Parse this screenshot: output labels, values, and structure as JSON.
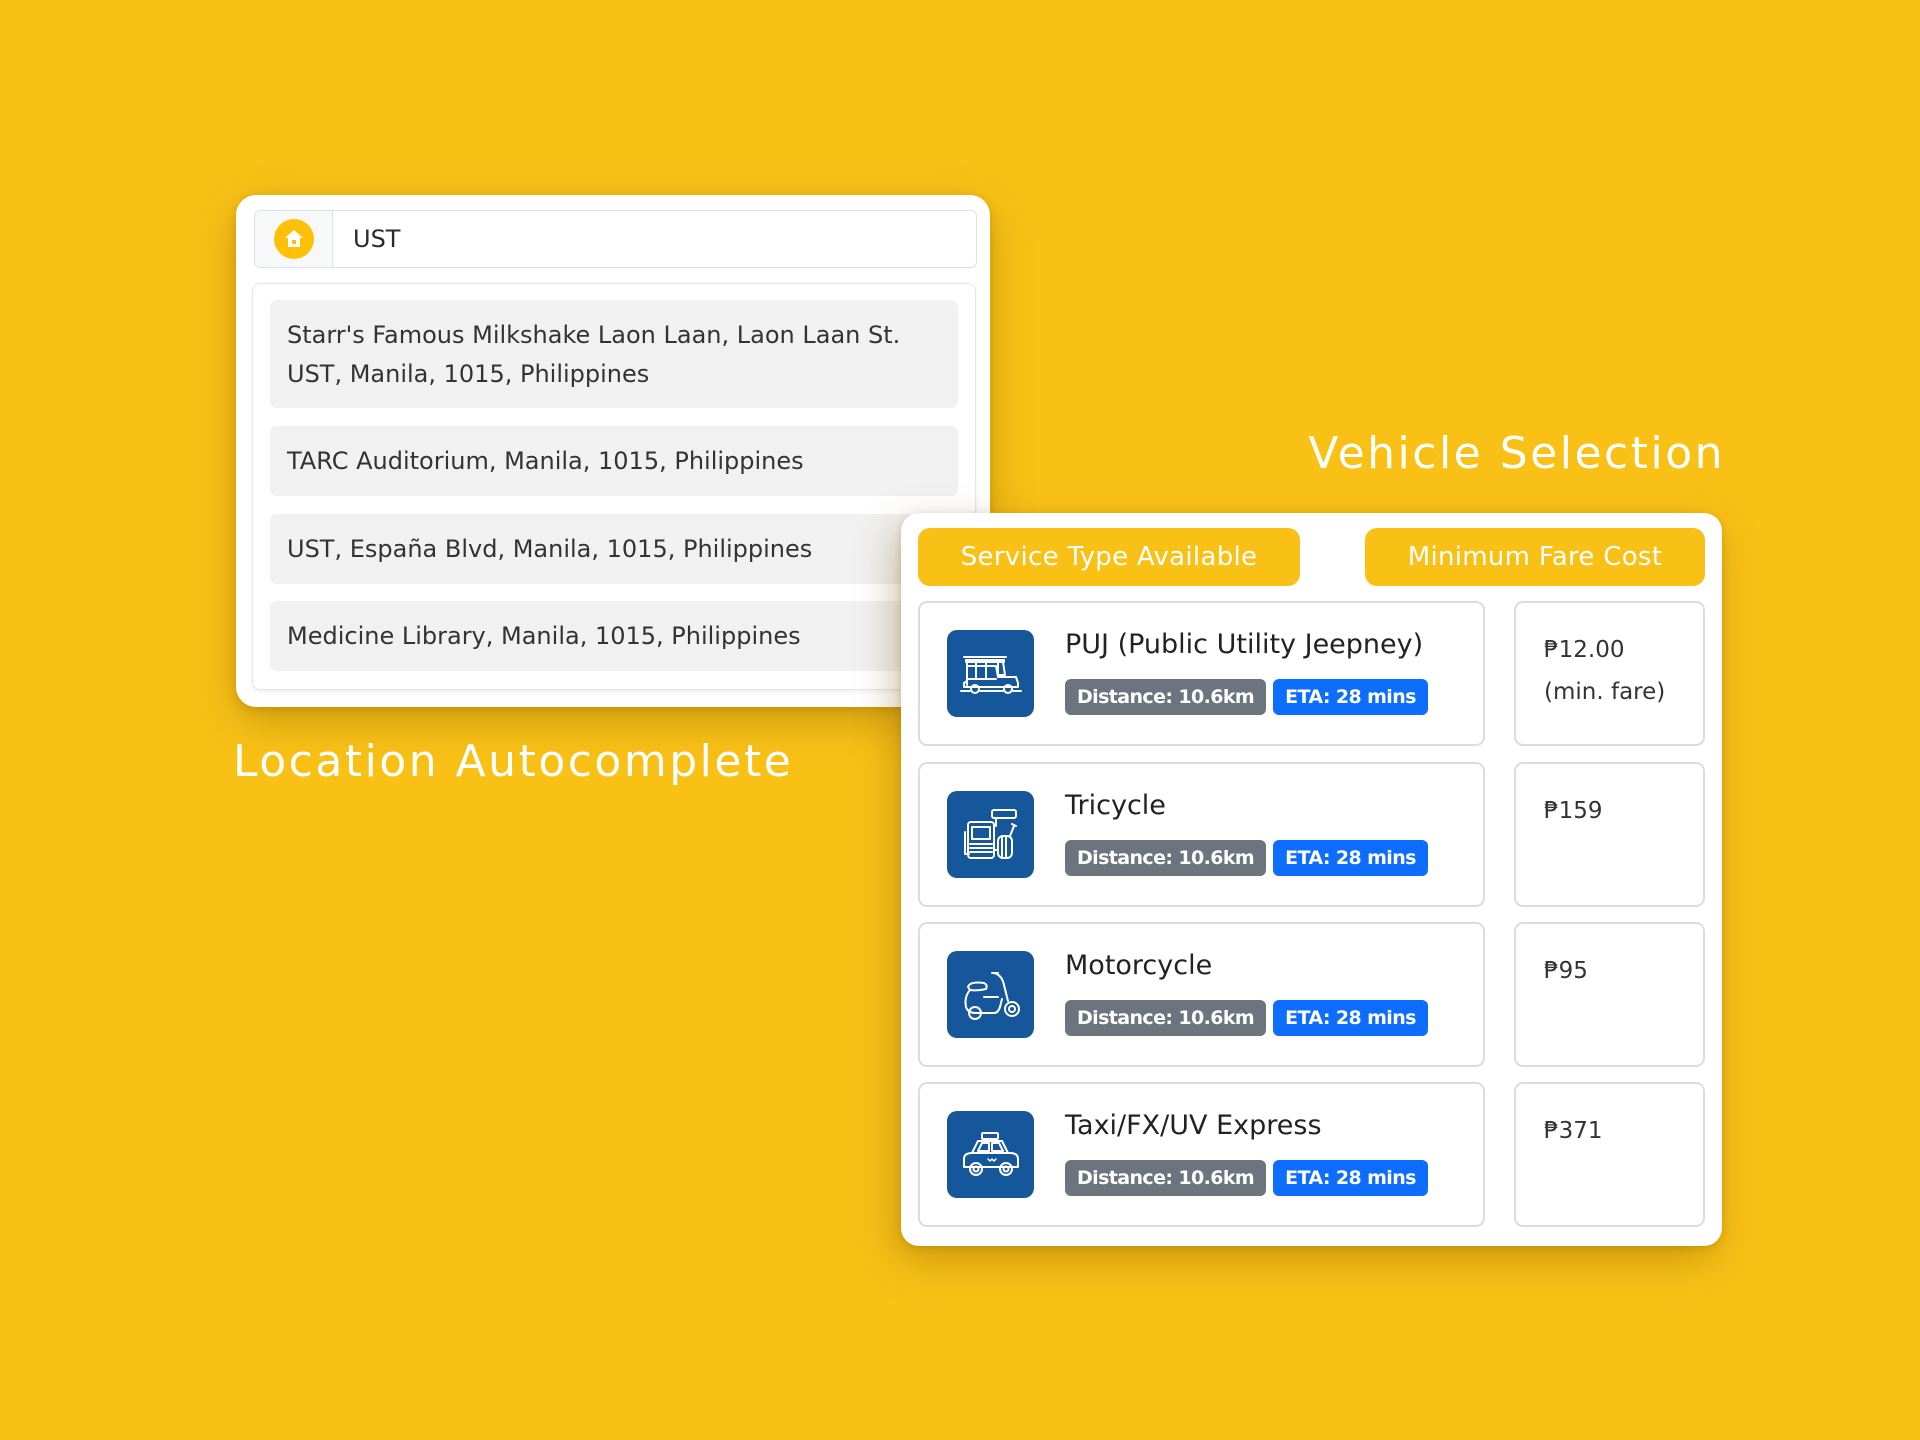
{
  "colors": {
    "background": "#F9C116",
    "accent": "#F9C116",
    "icon_bg": "#16579B",
    "badge_distance": "#6c757d",
    "badge_eta": "#0d6efd",
    "home_icon": "#FFC107"
  },
  "autocomplete": {
    "caption": "Location Autocomplete",
    "input": {
      "icon": "home-icon",
      "value": "UST"
    },
    "suggestions": [
      {
        "line1": "Starr's Famous Milkshake Laon Laan, Laon Laan St.",
        "line2": "UST, Manila, 1015, Philippines"
      },
      {
        "line1": "TARC Auditorium, Manila, 1015, Philippines"
      },
      {
        "line1": "UST, España Blvd, Manila, 1015, Philippines"
      },
      {
        "line1": "Medicine Library, Manila, 1015, Philippines"
      }
    ]
  },
  "vehicle_selection": {
    "caption": "Vehicle Selection",
    "headers": {
      "service": "Service Type Available",
      "fare": "Minimum Fare Cost"
    },
    "vehicles": [
      {
        "name": "PUJ (Public Utility Jeepney)",
        "icon": "jeepney-icon",
        "distance": "Distance: 10.6km",
        "eta": "ETA: 28 mins",
        "fare": "₱12.00",
        "fare_note": "(min. fare)"
      },
      {
        "name": "Tricycle",
        "icon": "tricycle-icon",
        "distance": "Distance: 10.6km",
        "eta": "ETA: 28 mins",
        "fare": "₱159",
        "fare_note": ""
      },
      {
        "name": "Motorcycle",
        "icon": "motorcycle-icon",
        "distance": "Distance: 10.6km",
        "eta": "ETA: 28 mins",
        "fare": "₱95",
        "fare_note": ""
      },
      {
        "name": "Taxi/FX/UV Express",
        "icon": "taxi-icon",
        "distance": "Distance: 10.6km",
        "eta": "ETA: 28 mins",
        "fare": "₱371",
        "fare_note": ""
      }
    ]
  }
}
